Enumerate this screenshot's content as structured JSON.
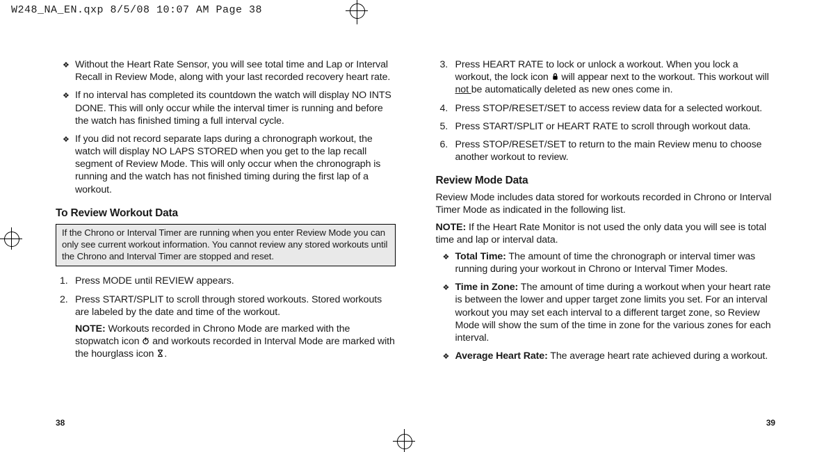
{
  "header": {
    "slug": "W248_NA_EN.qxp  8/5/08  10:07 AM  Page 38"
  },
  "left": {
    "bullets": [
      "Without the Heart Rate Sensor, you will see total time and Lap or Interval Recall in Review Mode, along with your last recorded recovery heart rate.",
      "If no interval has completed its countdown the watch will display NO INTS DONE. This will only occur while the interval timer is running and before the watch has finished timing a full interval cycle.",
      "If you did not record separate laps during a chronograph workout, the watch will display NO LAPS STORED when you get to the lap recall segment of Review Mode. This will only occur when the chronograph is running and the watch has not finished timing during the first lap of a workout."
    ],
    "heading": "To Review Workout Data",
    "boxnote": "If the Chrono or Interval Timer are running when you enter Review Mode you can only see current workout information. You cannot review any stored workouts until the Chrono and Interval Timer are stopped and reset.",
    "steps": {
      "s1": "Press MODE until REVIEW appears.",
      "s2": "Press START/SPLIT to scroll through stored workouts. Stored workouts are labeled by the date and time of the workout.",
      "s2_note_strong": "NOTE:",
      "s2_note_a": " Workouts recorded in Chrono Mode are marked with the stopwatch icon ",
      "s2_note_b": " and workouts recorded in Interval Mode are marked with the hourglass icon ",
      "s2_note_c": "."
    },
    "pagenum": "38"
  },
  "right": {
    "steps": {
      "s3_a": "Press HEART RATE to lock or unlock a workout. When you lock a workout, the lock icon ",
      "s3_b": " will appear next to the workout. This workout will ",
      "s3_not": "not ",
      "s3_c": "be automatically deleted as new ones come in.",
      "s4": "Press STOP/RESET/SET to access review data for a selected workout.",
      "s5": "Press START/SPLIT or HEART RATE to scroll through workout data.",
      "s6": "Press STOP/RESET/SET to return to the main Review menu to choose another workout to review."
    },
    "heading": "Review Mode Data",
    "para1": "Review Mode includes data stored for workouts recorded in Chrono or Interval Timer Mode as indicated in the following list.",
    "note_strong": "NOTE:",
    "note_text": " If the Heart Rate Monitor is not used the only data you will see is total time and lap or interval data.",
    "def": {
      "tt_label": "Total Time:",
      "tt_text": " The amount of time the chronograph or interval timer was running during your workout in Chrono or Interval Timer Modes.",
      "tz_label": "Time in Zone:",
      "tz_text": " The amount of time during a workout when your heart rate is between the lower and upper target zone limits you set. For an interval workout you may set each interval to a different target zone, so Review Mode will show the sum of the time in zone for the various zones for each interval.",
      "ahr_label": "Average Heart Rate:",
      "ahr_text": " The average heart rate achieved during a workout."
    },
    "pagenum": "39"
  }
}
